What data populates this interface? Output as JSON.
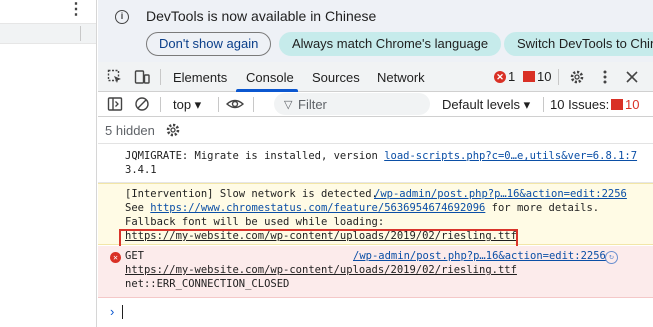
{
  "left": {
    "menu_icon": "kebab-menu-icon"
  },
  "infobar": {
    "icon": "info-icon",
    "message": "DevTools is now available in Chinese",
    "btn_dont": "Don't show again",
    "btn_always": "Always match Chrome's language",
    "btn_switch": "Switch DevTools to Chinese"
  },
  "tabs": {
    "elements": "Elements",
    "console": "Console",
    "sources": "Sources",
    "network": "Network",
    "errors": "1",
    "warnings": "10"
  },
  "toolbar": {
    "context": "top ▾",
    "filter_placeholder": "Filter",
    "levels": "Default levels ▾",
    "issues": "10 Issues:",
    "issues_count": "10"
  },
  "hidden": "5 hidden",
  "console": {
    "msg1": {
      "text": "JQMIGRATE: Migrate is installed, version ",
      "link": "load-scripts.php?c=0…e,utils&ver=6.8.1:7",
      "line2": "3.4.1"
    },
    "msg2": {
      "line1": "[Intervention] Slow network is detected. ",
      "source": "/wp-admin/post.php?p…16&action=edit:2256",
      "line2_pre": "See ",
      "line2_link": "https://www.chromestatus.com/feature/5636954674692096",
      "line2_post": " for more details.",
      "line3": "Fallback font will be used while loading:",
      "line4_link": "https://my-website.com/wp-content/uploads/2019/02/riesling.ttf"
    },
    "msg3": {
      "line1": "GET",
      "source": "/wp-admin/post.php?p…16&action=edit:2256",
      "line2_link": "https://my-website.com/wp-content/uploads/2019/02/riesling.ttf",
      "line3": "net::ERR_CONNECTION_CLOSED"
    }
  },
  "colors": {
    "accent": "#0b57d0",
    "error": "#d93025",
    "warn_bg": "#fffbe5",
    "error_bg": "#fcebeb",
    "info_bg": "#eef1f6",
    "pill_bg": "#c6ebeb",
    "highlight_border": "#d9342b"
  }
}
